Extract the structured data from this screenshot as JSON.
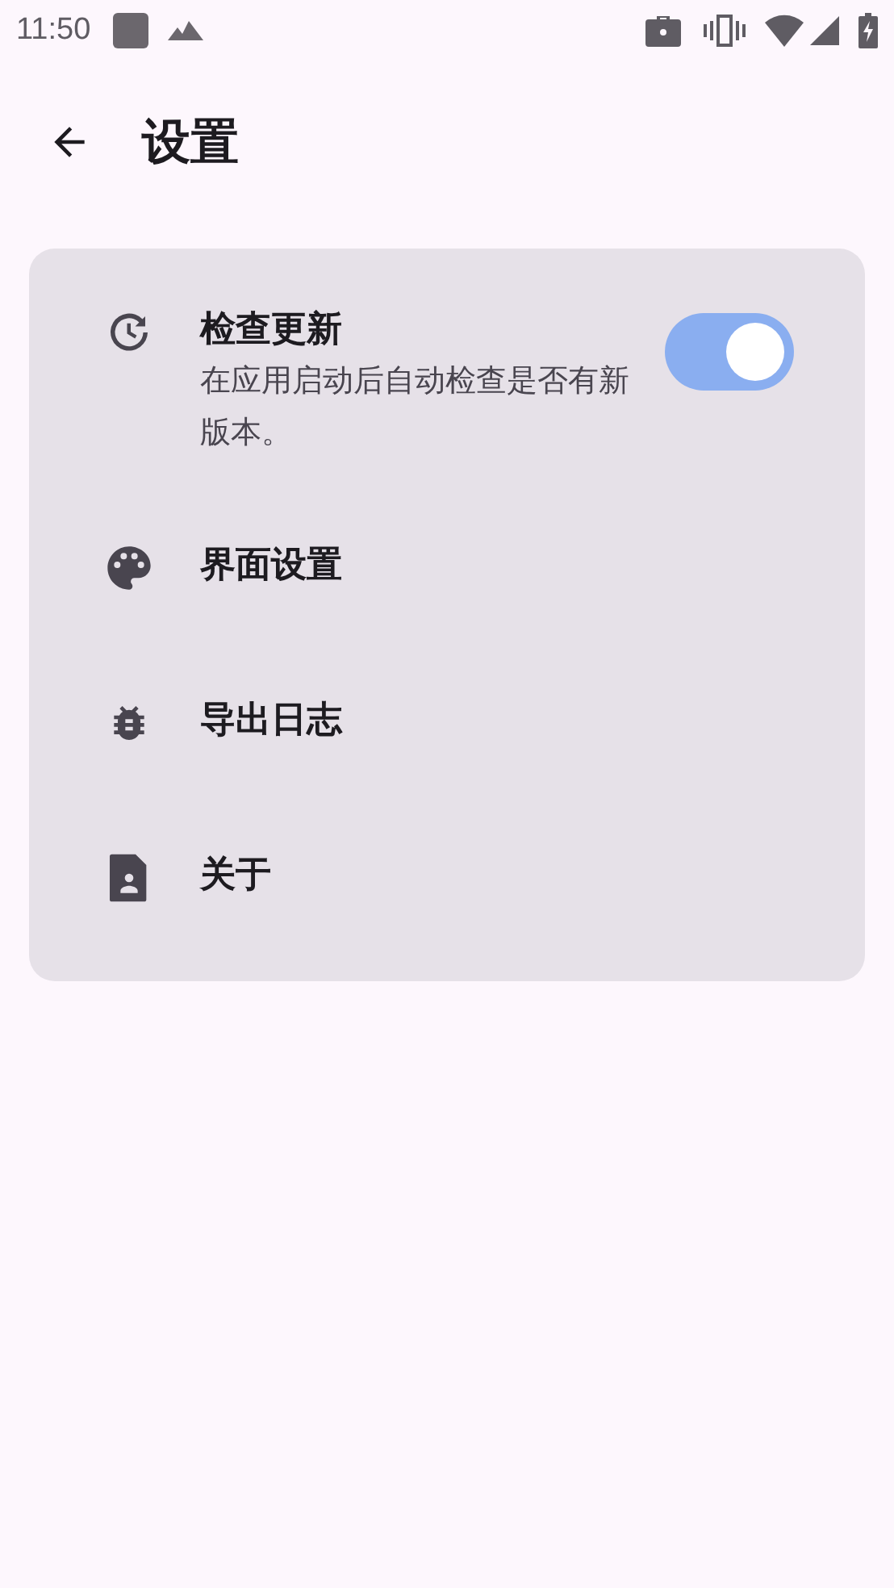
{
  "status_bar": {
    "time": "11:50"
  },
  "app_bar": {
    "title": "设置"
  },
  "settings": [
    {
      "kind": "switch",
      "title": "检查更新",
      "subtitle": "在应用启动后自动检查是否有新版本。",
      "on": true
    },
    {
      "kind": "link",
      "title": "界面设置"
    },
    {
      "kind": "link",
      "title": "导出日志"
    },
    {
      "kind": "link",
      "title": "关于"
    }
  ]
}
